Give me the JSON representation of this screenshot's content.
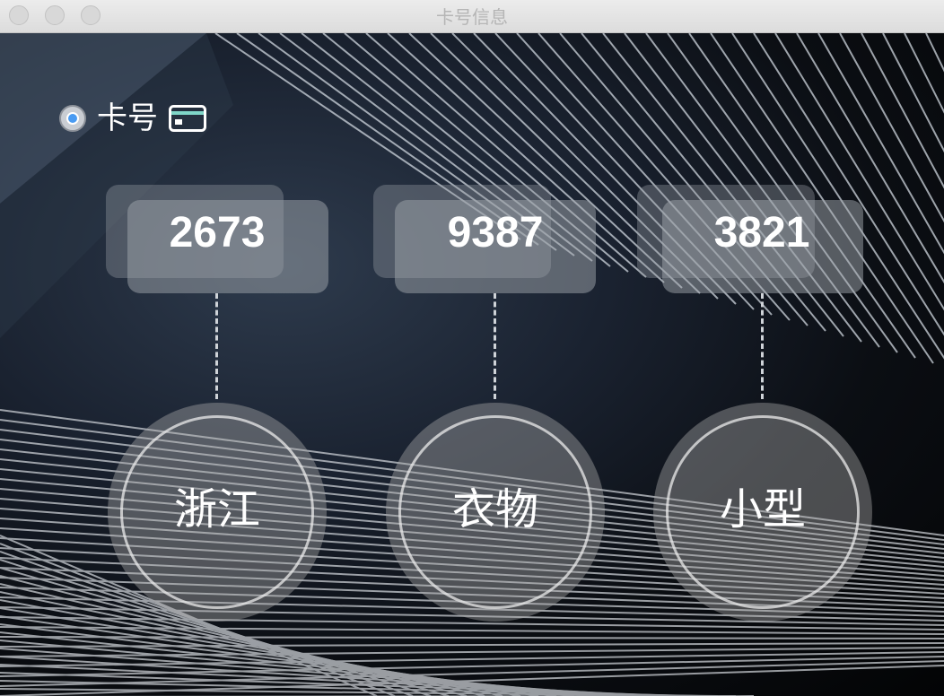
{
  "window": {
    "title": "卡号信息"
  },
  "selector": {
    "label": "卡号",
    "selected": true,
    "icon": "card-icon"
  },
  "items": [
    {
      "number": "2673",
      "label": "浙江"
    },
    {
      "number": "9387",
      "label": "衣物"
    },
    {
      "number": "3821",
      "label": "小型"
    }
  ],
  "colors": {
    "radio_accent": "#4a9bf2",
    "card_icon_stroke": "#ffffff",
    "card_icon_stripe": "#7fd6c8"
  }
}
